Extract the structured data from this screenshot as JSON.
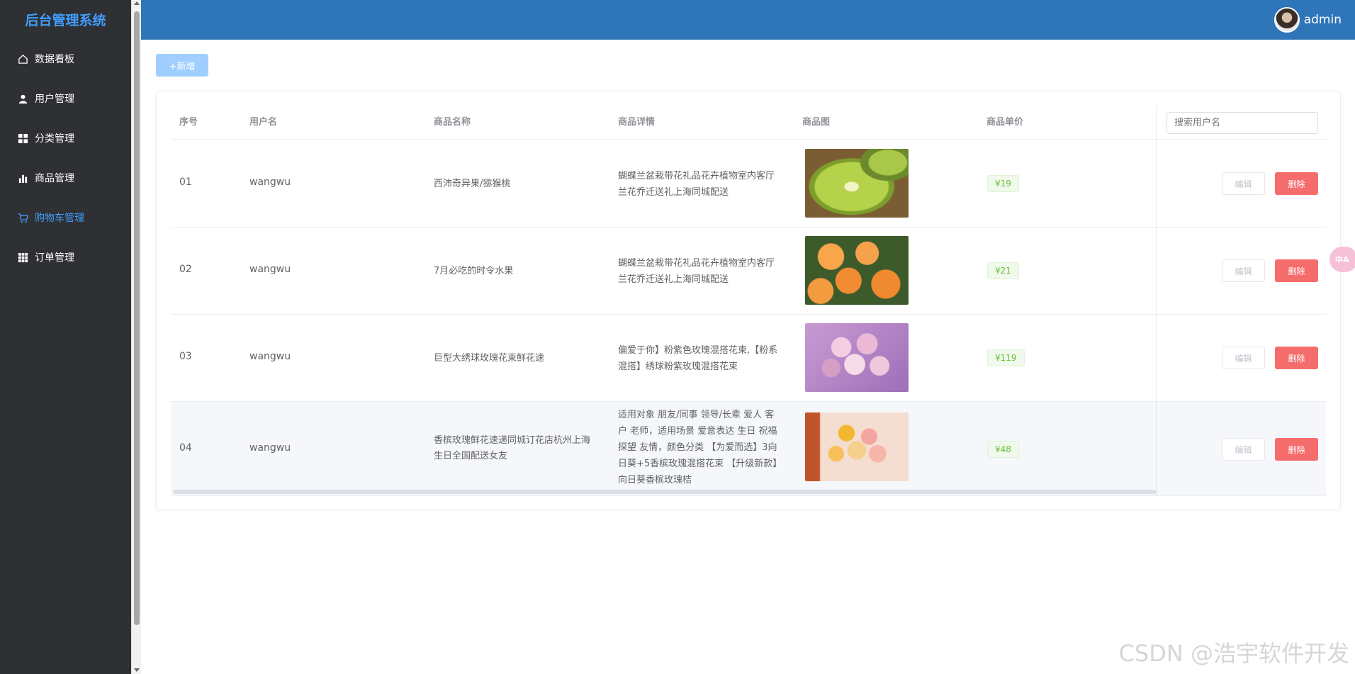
{
  "app": {
    "title": "后台管理系统"
  },
  "colors": {
    "sidebar_bg": "#2f3033",
    "header_bg": "#2f75b9",
    "accent": "#409eff",
    "danger": "#f56c6c",
    "success": "#67c23a"
  },
  "sidebar": {
    "items": [
      {
        "label": "数据看板",
        "icon": "home-icon",
        "active": false
      },
      {
        "label": "用户管理",
        "icon": "user-icon",
        "active": false
      },
      {
        "label": "分类管理",
        "icon": "grid-icon",
        "active": false
      },
      {
        "label": "商品管理",
        "icon": "bar-chart-icon",
        "active": false
      },
      {
        "label": "购物车管理",
        "icon": "cart-icon",
        "active": true
      },
      {
        "label": "订单管理",
        "icon": "apps-icon",
        "active": false
      }
    ]
  },
  "header": {
    "username": "admin"
  },
  "toolbar": {
    "add_label": "+新增"
  },
  "table": {
    "columns": [
      "序号",
      "用户名",
      "商品名称",
      "商品详情",
      "商品图",
      "商品单价"
    ],
    "search_placeholder": "搜索用户名",
    "edit_label": "编辑",
    "delete_label": "删除",
    "rows": [
      {
        "index": "01",
        "username": "wangwu",
        "name": "西沛奇异果/猕猴桃",
        "detail": "蝴蝶兰盆栽带花礼品花卉植物室内客厅兰花乔迁送礼上海同城配送",
        "image": "kiwi",
        "price": "¥19"
      },
      {
        "index": "02",
        "username": "wangwu",
        "name": "7月必吃的时令水果",
        "detail": "蝴蝶兰盆栽带花礼品花卉植物室内客厅兰花乔迁送礼上海同城配送",
        "image": "apricot",
        "price": "¥21"
      },
      {
        "index": "03",
        "username": "wangwu",
        "name": "巨型大绣球玫瑰花束鲜花速",
        "detail": "偏爱于你】粉紫色玫瑰混搭花束,【粉系混搭】绣球粉紫玫瑰混搭花束",
        "image": "roses",
        "price": "¥119"
      },
      {
        "index": "04",
        "username": "wangwu",
        "name": "香槟玫瑰鲜花速递同城订花店杭州上海生日全国配送女友",
        "detail": "适用对象 朋友/同事 领导/长辈 爱人 客户 老师，适用场景 爱意表达 生日 祝福 探望 友情，颜色分类 【为爱而选】3向日葵+5香槟玫瑰混搭花束 【升级新款】向日葵香槟玫瑰桔",
        "image": "sunflower",
        "price": "¥48"
      }
    ]
  },
  "floating": {
    "translate_label": "中A"
  },
  "watermark": "CSDN @浩宇软件开发"
}
